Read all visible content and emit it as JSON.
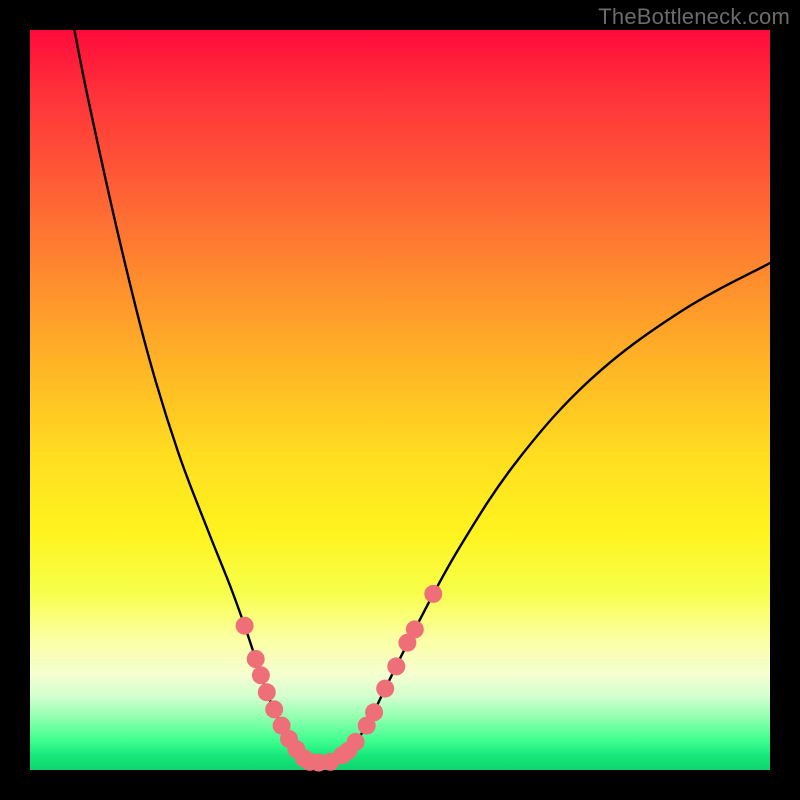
{
  "watermark": "TheBottleneck.com",
  "chart_data": {
    "type": "line",
    "title": "",
    "xlabel": "",
    "ylabel": "",
    "xlim": [
      0,
      100
    ],
    "ylim": [
      0,
      100
    ],
    "series": [
      {
        "name": "bottleneck-curve",
        "x": [
          6,
          8,
          12,
          16,
          20,
          24,
          27,
          29,
          30.5,
          32,
          34,
          36,
          37.5,
          39,
          41,
          43,
          45.5,
          48,
          52,
          58,
          66,
          76,
          88,
          100
        ],
        "values": [
          100,
          90,
          72,
          56,
          43,
          32.5,
          25,
          19.5,
          15,
          10.5,
          6,
          2.8,
          1.2,
          1.0,
          1.2,
          2.6,
          6,
          11,
          19,
          30,
          42,
          53,
          62,
          68.5
        ]
      }
    ],
    "markers": {
      "name": "highlight-points",
      "color": "#ef6f78",
      "radius": 9,
      "points": [
        {
          "x": 29.0,
          "y": 19.5
        },
        {
          "x": 30.5,
          "y": 15.0
        },
        {
          "x": 31.2,
          "y": 12.8
        },
        {
          "x": 32.0,
          "y": 10.5
        },
        {
          "x": 33.0,
          "y": 8.2
        },
        {
          "x": 34.0,
          "y": 6.0
        },
        {
          "x": 35.0,
          "y": 4.2
        },
        {
          "x": 36.0,
          "y": 2.8
        },
        {
          "x": 37.0,
          "y": 1.6
        },
        {
          "x": 37.8,
          "y": 1.1
        },
        {
          "x": 39.0,
          "y": 1.0
        },
        {
          "x": 40.6,
          "y": 1.1
        },
        {
          "x": 42.2,
          "y": 2.0
        },
        {
          "x": 43.0,
          "y": 2.6
        },
        {
          "x": 44.0,
          "y": 3.8
        },
        {
          "x": 45.5,
          "y": 6.0
        },
        {
          "x": 46.5,
          "y": 7.8
        },
        {
          "x": 48.0,
          "y": 11.0
        },
        {
          "x": 49.5,
          "y": 14.0
        },
        {
          "x": 51.0,
          "y": 17.2
        },
        {
          "x": 52.0,
          "y": 19.0
        },
        {
          "x": 54.5,
          "y": 23.8
        }
      ]
    },
    "background_gradient": {
      "top": "#ff0a3a",
      "mid": "#ffdf20",
      "bottom": "#0fd470"
    }
  }
}
